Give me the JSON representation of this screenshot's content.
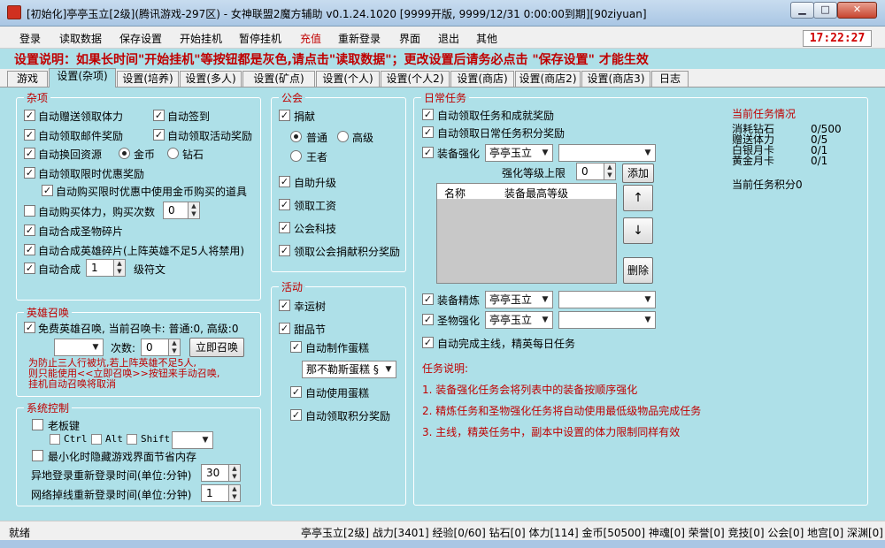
{
  "window": {
    "title": "[初始化]亭亭玉立[2级](腾讯游戏-297区) - 女神联盟2魔方辅助 v0.1.24.1020 [9999开版, 9999/12/31 0:00:00到期][90ziyuan]"
  },
  "menu": [
    "登录",
    "读取数据",
    "保存设置",
    "开始挂机",
    "暂停挂机",
    "充值",
    "重新登录",
    "界面",
    "退出",
    "其他"
  ],
  "clock": "17:22:27",
  "notice": "设置说明：如果长时间\"开始挂机\"等按钮都是灰色,请点击\"读取数据\"；更改设置后请务必点击 \"保存设置\" 才能生效",
  "tabs": [
    "游戏",
    "设置(杂项)",
    "设置(培养)",
    "设置(多人)",
    "设置(矿点)",
    "设置(个人)",
    "设置(个人2)",
    "设置(商店)",
    "设置(商店2)",
    "设置(商店3)",
    "日志"
  ],
  "misc": {
    "title": "杂项",
    "gift_stamina": "自动赠送领取体力",
    "auto_signin": "自动签到",
    "mail_reward": "自动领取邮件奖励",
    "activity_reward": "自动领取活动奖励",
    "auto_exchange": "自动换回资源",
    "gold": "金币",
    "diamond": "钻石",
    "limited_reward": "自动领取限时优惠奖励",
    "limited_buy": "自动购买限时优惠中使用金币购买的道具",
    "buy_stamina": "自动购买体力，购买次数",
    "buy_stamina_count": "0",
    "relic_fragment": "自动合成圣物碎片",
    "hero_fragment": "自动合成英雄碎片(上阵英雄不足5人将禁用)",
    "auto_compose": "自动合成",
    "compose_level": "1",
    "rune_label": "级符文"
  },
  "hero": {
    "title": "英雄召唤",
    "free_summon": "免费英雄召唤, 当前召唤卡:   普通:0,   高级:0",
    "times_label": "次数:",
    "times_value": "0",
    "summon_btn": "立即召唤",
    "warning": "为防止三人行被坑,若上阵英雄不足5人,\n则只能使用<<立即召唤>>按钮来手动召唤,\n挂机自动召唤将取消"
  },
  "system": {
    "title": "系统控制",
    "boss_key": "老板键",
    "ctrl": "Ctrl",
    "alt": "Alt",
    "shift": "Shift",
    "minimize_hide": "最小化时隐藏游戏界面节省内存",
    "relogin_remote": "异地登录重新登录时间(单位:分钟)",
    "relogin_remote_value": "30",
    "relogin_net": "网络掉线重新登录时间(单位:分钟)",
    "relogin_net_value": "1"
  },
  "guild": {
    "title": "公会",
    "donate": "捐献",
    "normal": "普通",
    "advanced": "高级",
    "king": "王者",
    "auto_upgrade": "自助升级",
    "salary": "领取工资",
    "tech": "公会科技",
    "donate_reward": "领取公会捐献积分奖励"
  },
  "activity": {
    "title": "活动",
    "lucky_tree": "幸运树",
    "dessert": "甜品节",
    "make_cake": "自动制作蛋糕",
    "cake_select": "那不勒斯蛋糕 §",
    "use_cake": "自动使用蛋糕",
    "points_reward": "自动领取积分奖励"
  },
  "daily": {
    "title": "日常任务",
    "task_reward": "自动领取任务和成就奖励",
    "points_reward": "自动领取日常任务积分奖励",
    "enhance": "装备强化",
    "char_select": "亭亭玉立",
    "enhance_limit": "强化等级上限",
    "enhance_limit_value": "0",
    "add_btn": "添加",
    "col_name": "名称",
    "col_level": "装备最高等级",
    "up_btn": "↑",
    "down_btn": "↓",
    "delete_btn": "删除",
    "refine": "装备精炼",
    "relic_enhance": "圣物强化",
    "main_line": "自动完成主线，精英每日任务",
    "desc_title": "任务说明:",
    "desc": [
      "1.  装备强化任务会将列表中的装备按顺序强化",
      "2.  精炼任务和圣物强化任务将自动使用最低级物品完成任务",
      "3.  主线，精英任务中，副本中设置的体力限制同样有效"
    ]
  },
  "status_info": {
    "title": "当前任务情况",
    "rows": [
      {
        "label": "消耗钻石",
        "value": "0/500"
      },
      {
        "label": "赠送体力",
        "value": "0/5"
      },
      {
        "label": "白银月卡",
        "value": "0/1"
      },
      {
        "label": "黄金月卡",
        "value": "0/1"
      }
    ],
    "points": "当前任务积分0"
  },
  "statusbar": {
    "left": "就绪",
    "right": "亭亭玉立[2级] 战力[3401] 经验[0/60] 钻石[0] 体力[114] 金币[50500] 神魂[0] 荣誉[0] 竞技[0] 公会[0] 地宫[0] 深渊[0]"
  }
}
